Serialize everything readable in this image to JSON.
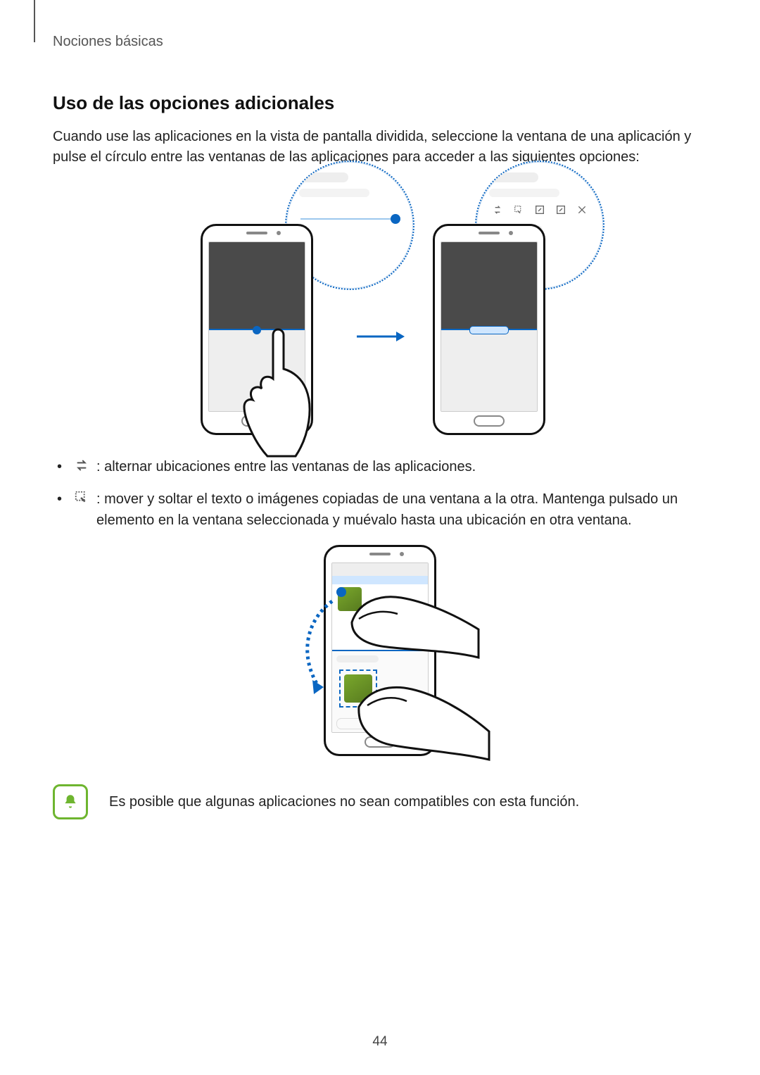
{
  "breadcrumb": "Nociones básicas",
  "heading": "Uso de las opciones adicionales",
  "intro": "Cuando use las aplicaciones en la vista de pantalla dividida, seleccione la ventana de una aplicación y pulse el círculo entre las ventanas de las aplicaciones para acceder a las siguientes opciones:",
  "bullets": [
    {
      "icon": "swap-icon",
      "text": " : alternar ubicaciones entre las ventanas de las aplicaciones."
    },
    {
      "icon": "drag-copy-icon",
      "text": " : mover y soltar el texto o imágenes copiadas de una ventana a la otra. Mantenga pulsado un elemento en la ventana seleccionada y muévalo hasta una ubicación en otra ventana."
    }
  ],
  "note": "Es posible que algunas aplicaciones no sean compatibles con esta función.",
  "page_number": "44",
  "toolbar_glyphs": [
    "swap",
    "drag",
    "min",
    "max",
    "close"
  ]
}
